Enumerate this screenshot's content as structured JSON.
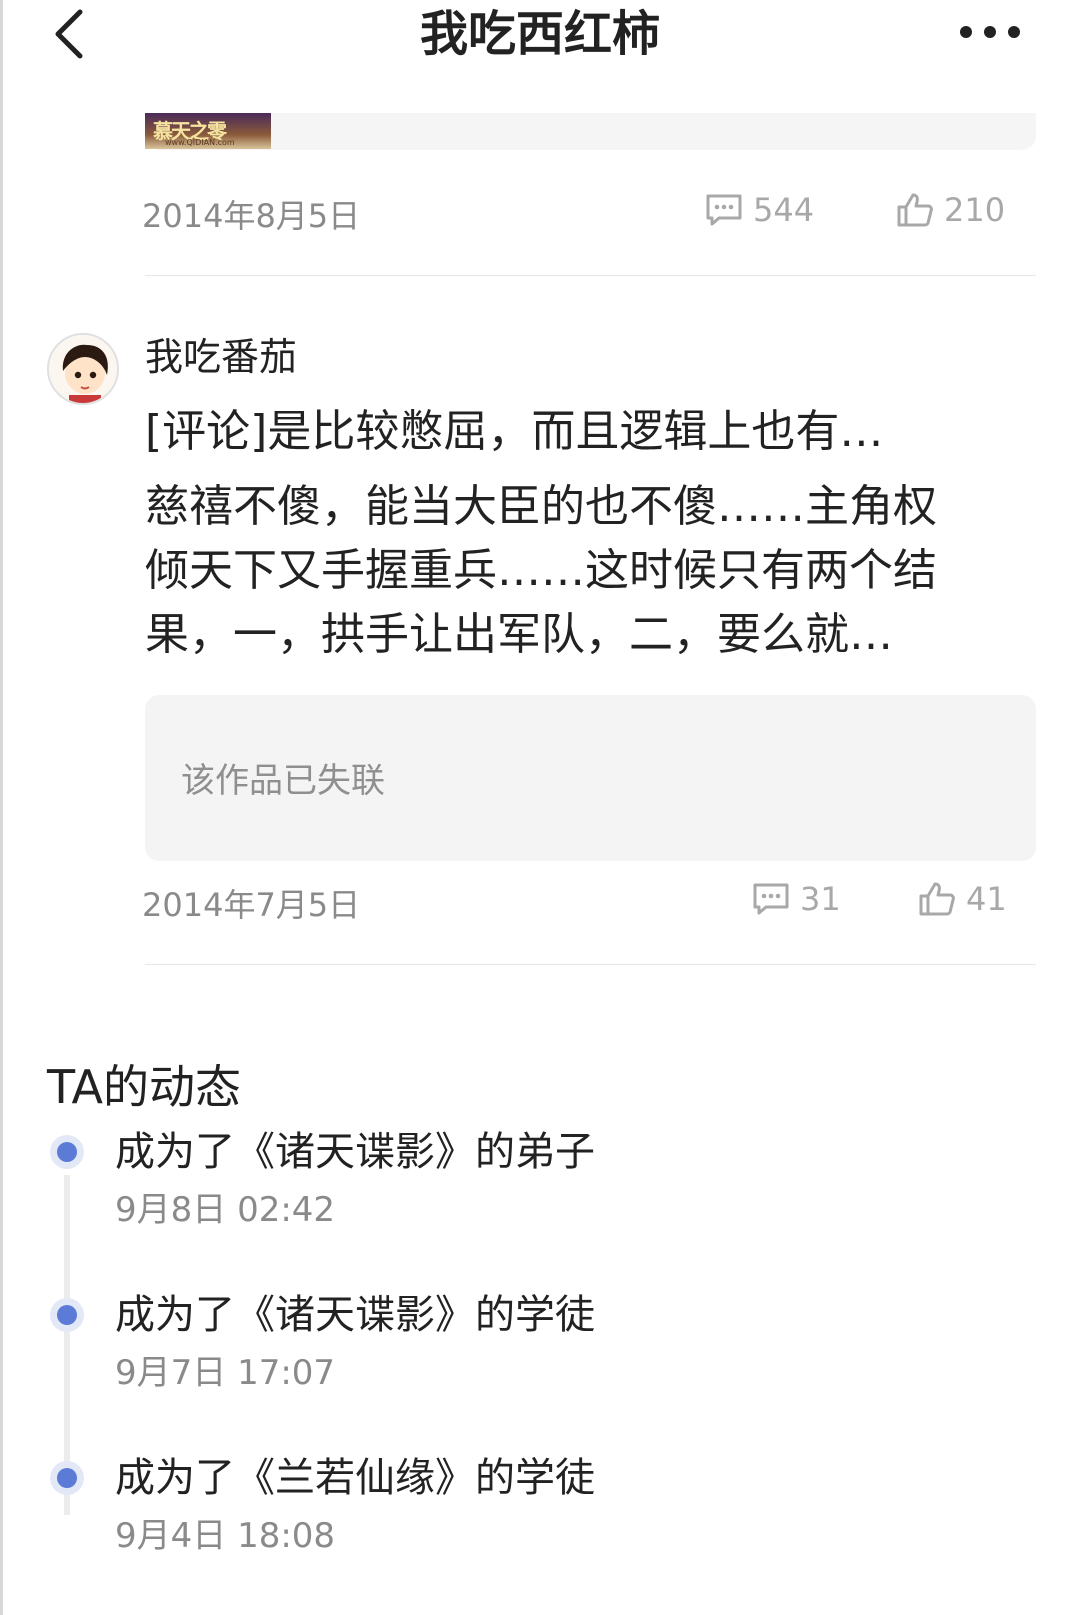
{
  "header": {
    "title": "我吃西红柿"
  },
  "prev_post": {
    "thumb_title": "慕天之零",
    "thumb_site": "www.QIDIAN.com",
    "date": "2014年8月5日",
    "comments": "544",
    "likes": "210"
  },
  "comment": {
    "username": "我吃番茄",
    "title": "[评论]是比较憋屈，而且逻辑上也有…",
    "body_lines": [
      "慈禧不傻，能当大臣的也不傻……主角权",
      "倾天下又手握重兵……这时候只有两个结",
      "果，一，拱手让出军队，二，要么就…"
    ],
    "lost_text": "该作品已失联",
    "date": "2014年7月5日",
    "comments": "31",
    "likes": "41"
  },
  "activity": {
    "title": "TA的动态",
    "items": [
      {
        "text": "成为了《诸天谍影》的弟子",
        "time": "9月8日 02:42"
      },
      {
        "text": "成为了《诸天谍影》的学徒",
        "time": "9月7日 17:07"
      },
      {
        "text": "成为了《兰若仙缘》的学徒",
        "time": "9月4日 18:08"
      }
    ]
  },
  "colors": {
    "accent_dot": "#5b7bd6",
    "muted_text": "#8a8a8a",
    "card_bg": "#f4f4f4"
  }
}
